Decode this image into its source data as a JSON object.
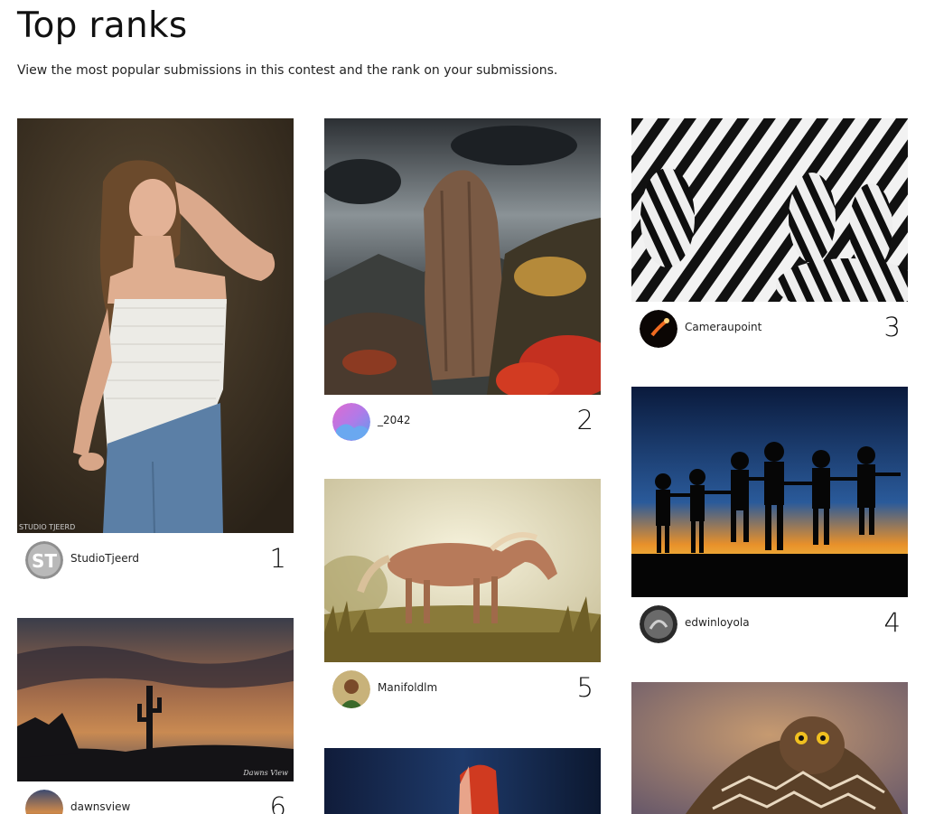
{
  "header": {
    "title": "Top ranks",
    "subtitle": "View the most popular submissions in this contest and the rank on your submissions."
  },
  "submissions": [
    {
      "rank": "1",
      "username": "StudioTjeerd",
      "photo": "portrait of woman in white lace top",
      "avatar": "ST",
      "watermark": "STUDIO TJEERD"
    },
    {
      "rank": "2",
      "username": "_2042",
      "photo": "rock pillar mountain landscape with stormy sky"
    },
    {
      "rank": "3",
      "username": "Cameraupoint",
      "photo": "herd of zebras black and white"
    },
    {
      "rank": "4",
      "username": "edwinloyola",
      "photo": "children silhouettes at sunset"
    },
    {
      "rank": "5",
      "username": "Manifoldlm",
      "photo": "horse in misty grassland"
    },
    {
      "rank": "6",
      "username": "dawnsview",
      "photo": "saguaro cactus at sunset",
      "watermark": "Dawns View"
    },
    {
      "rank": "",
      "username": "",
      "photo": "woman with red veil"
    },
    {
      "rank": "",
      "username": "",
      "photo": "owl in flight"
    }
  ]
}
